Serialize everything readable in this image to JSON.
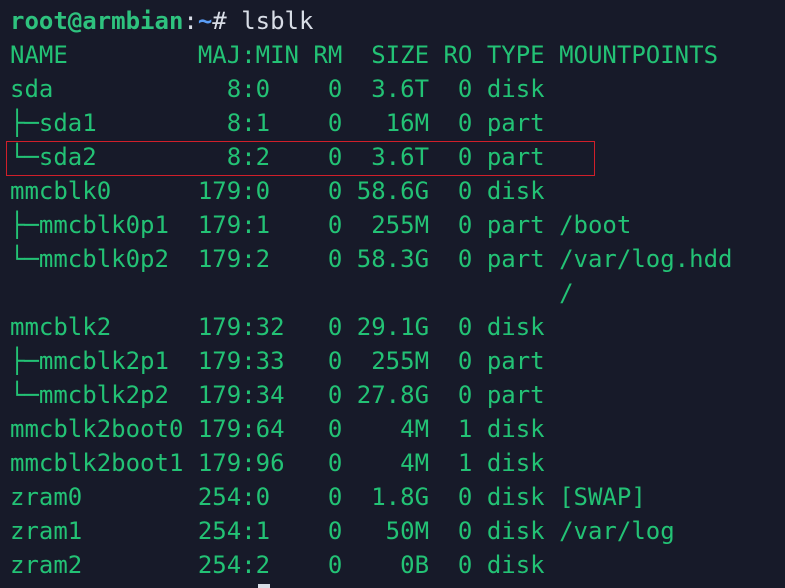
{
  "prompt": {
    "user_host": "root@armbian",
    "separator": ":",
    "path": "~",
    "symbol": "# ",
    "command": "lsblk"
  },
  "output_lines": [
    "NAME         MAJ:MIN RM  SIZE RO TYPE MOUNTPOINTS",
    "sda            8:0    0  3.6T  0 disk",
    "├─sda1         8:1    0   16M  0 part",
    "└─sda2         8:2    0  3.6T  0 part",
    "mmcblk0      179:0    0 58.6G  0 disk",
    "├─mmcblk0p1  179:1    0  255M  0 part /boot",
    "└─mmcblk0p2  179:2    0 58.3G  0 part /var/log.hdd",
    "                                      /",
    "mmcblk2      179:32   0 29.1G  0 disk",
    "├─mmcblk2p1  179:33   0  255M  0 part",
    "└─mmcblk2p2  179:34   0 27.8G  0 part",
    "mmcblk2boot0 179:64   0    4M  1 disk",
    "mmcblk2boot1 179:96   0    4M  1 disk",
    "zram0        254:0    0  1.8G  0 disk [SWAP]",
    "zram1        254:1    0   50M  0 disk /var/log",
    "zram2        254:2    0    0B  0 disk"
  ],
  "highlighted_row_index": 3,
  "colors": {
    "background": "#171a29",
    "output_green": "#23c275",
    "prompt_user": "#2ec27e",
    "prompt_path": "#5a9df5",
    "command_text": "#d8dde6",
    "highlight_border": "#d01f2a"
  }
}
